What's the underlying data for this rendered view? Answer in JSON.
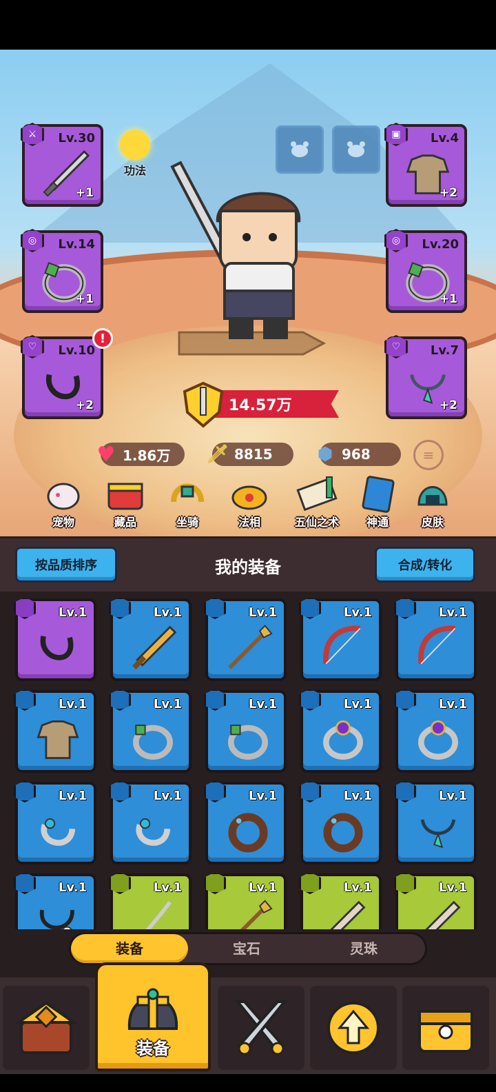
{
  "equipped": {
    "left": [
      {
        "slot": "weapon",
        "level": "Lv.30",
        "plus": "+1"
      },
      {
        "slot": "ring",
        "level": "Lv.14",
        "plus": "+1"
      },
      {
        "slot": "necklace",
        "level": "Lv.10",
        "plus": "+2",
        "alert": "!"
      }
    ],
    "right": [
      {
        "slot": "armor",
        "level": "Lv.4",
        "plus": "+2"
      },
      {
        "slot": "ring",
        "level": "Lv.20",
        "plus": "+1"
      },
      {
        "slot": "necklace",
        "level": "Lv.7",
        "plus": "+2"
      }
    ]
  },
  "gongfa_label": "功法",
  "power": "14.57万",
  "stats": {
    "hp": "1.86万",
    "attack": "8815",
    "defense": "968"
  },
  "features": [
    "宠物",
    "藏品",
    "坐骑",
    "法相",
    "五仙之术",
    "神通",
    "皮肤"
  ],
  "inventory": {
    "sort_button": "按品质排序",
    "title": "我的装备",
    "merge_button": "合成/转化",
    "items": [
      {
        "rarity": "purple",
        "type": "necklace-black",
        "level": "Lv.1"
      },
      {
        "rarity": "blue",
        "type": "sword-gold",
        "level": "Lv.1"
      },
      {
        "rarity": "blue",
        "type": "spear",
        "level": "Lv.1"
      },
      {
        "rarity": "blue",
        "type": "bow",
        "level": "Lv.1"
      },
      {
        "rarity": "blue",
        "type": "bow",
        "level": "Lv.1"
      },
      {
        "rarity": "blue",
        "type": "armor-cloth",
        "level": "Lv.1"
      },
      {
        "rarity": "blue",
        "type": "ring-green",
        "level": "Lv.1"
      },
      {
        "rarity": "blue",
        "type": "ring-green",
        "level": "Lv.1"
      },
      {
        "rarity": "blue",
        "type": "ring-purple",
        "level": "Lv.1"
      },
      {
        "rarity": "blue",
        "type": "ring-purple",
        "level": "Lv.1"
      },
      {
        "rarity": "blue",
        "type": "claw-ring",
        "level": "Lv.1"
      },
      {
        "rarity": "blue",
        "type": "claw-ring",
        "level": "Lv.1"
      },
      {
        "rarity": "blue",
        "type": "ring-brown",
        "level": "Lv.1"
      },
      {
        "rarity": "blue",
        "type": "ring-brown",
        "level": "Lv.1"
      },
      {
        "rarity": "blue",
        "type": "necklace-tooth",
        "level": "Lv.1"
      },
      {
        "rarity": "blue",
        "type": "necklace-eye",
        "level": "Lv.1"
      },
      {
        "rarity": "green",
        "type": "whip",
        "level": "Lv.1"
      },
      {
        "rarity": "green",
        "type": "spear",
        "level": "Lv.1"
      },
      {
        "rarity": "green",
        "type": "sword-gem",
        "level": "Lv.1"
      },
      {
        "rarity": "green",
        "type": "sword-gem",
        "level": "Lv.1"
      }
    ]
  },
  "tabs": {
    "equipment": "装备",
    "gems": "宝石",
    "orbs": "灵珠"
  },
  "nav": {
    "equipment_label": "装备"
  },
  "colors": {
    "purple": "#a65ad9",
    "blue": "#2e8ed8",
    "green": "#a7c93a",
    "gold": "#ffc42e",
    "panel": "#271e20"
  }
}
